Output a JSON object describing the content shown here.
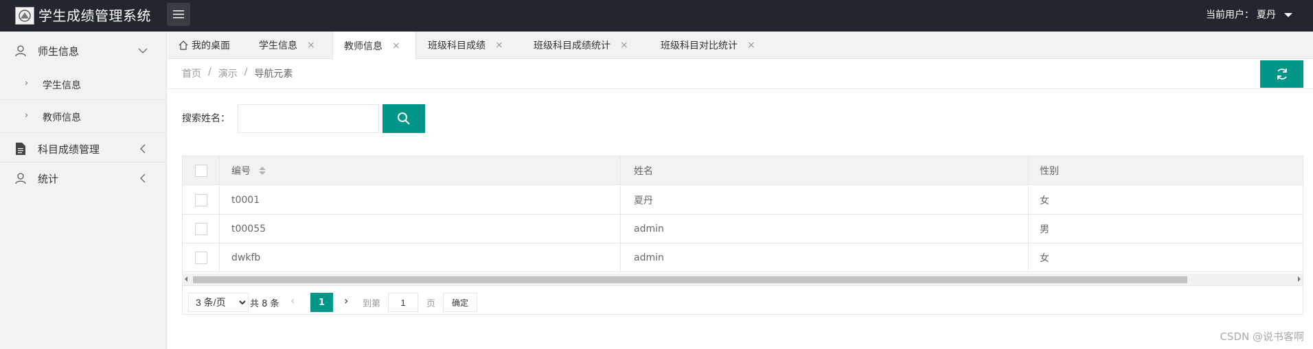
{
  "header": {
    "title": "学生成绩管理系统",
    "user_label": "当前用户：",
    "user_name": "夏丹"
  },
  "sidebar": {
    "groups": [
      {
        "label": "师生信息",
        "icon": "user-icon",
        "expanded": true,
        "children": [
          {
            "label": "学生信息"
          },
          {
            "label": "教师信息"
          }
        ]
      },
      {
        "label": "科目成绩管理",
        "icon": "document-icon",
        "expanded": false
      },
      {
        "label": "统计",
        "icon": "user-icon",
        "expanded": false
      }
    ]
  },
  "tabs": [
    {
      "label": "我的桌面",
      "icon": "home-icon",
      "closable": false
    },
    {
      "label": "学生信息",
      "closable": true
    },
    {
      "label": "教师信息",
      "closable": true,
      "active": true
    },
    {
      "label": "班级科目成绩",
      "closable": true
    },
    {
      "label": "班级科目成绩统计",
      "closable": true
    },
    {
      "label": "班级科目对比统计",
      "closable": true
    }
  ],
  "tab_close_glyph": "×",
  "breadcrumb": {
    "items": [
      "首页",
      "演示",
      "导航元素"
    ],
    "separator": "/"
  },
  "search": {
    "label": "搜索姓名：",
    "value": "",
    "placeholder": ""
  },
  "table": {
    "columns": [
      "编号",
      "姓名",
      "性别"
    ],
    "rows": [
      {
        "id": "t0001",
        "name": "夏丹",
        "sex": "女"
      },
      {
        "id": "t00055",
        "name": "admin",
        "sex": "男"
      },
      {
        "id": "dwkfb",
        "name": "admin",
        "sex": "女"
      }
    ]
  },
  "pagination": {
    "page_size": "3 条/页",
    "total": "共 8 条",
    "current_page": "1",
    "goto_label": "到第",
    "goto_value": "1",
    "page_suffix": "页",
    "confirm_label": "确定",
    "prev_glyph": "‹",
    "next_glyph": "›"
  },
  "watermark": "CSDN @说书客啊",
  "colors": {
    "accent": "#009688",
    "header_bg": "#23262e",
    "sidebar_bg": "#f2f2f2"
  }
}
